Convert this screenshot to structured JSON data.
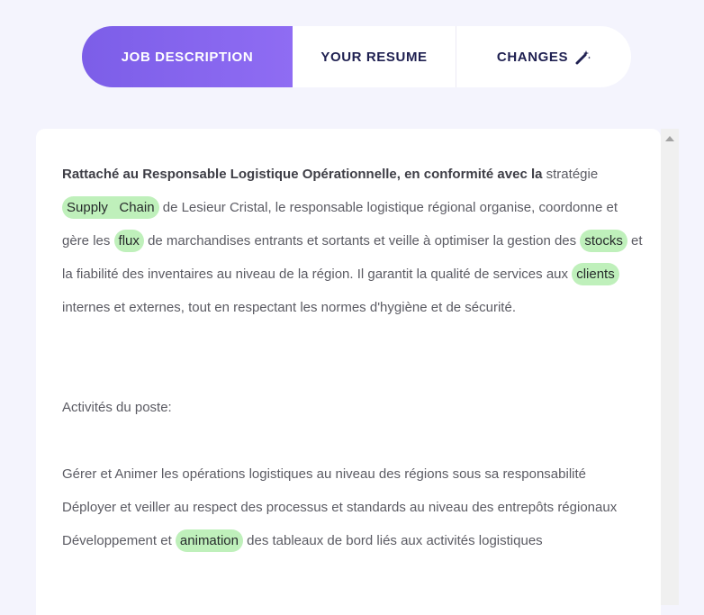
{
  "tabs": [
    {
      "label": "JOB DESCRIPTION",
      "active": true
    },
    {
      "label": "YOUR RESUME",
      "active": false
    },
    {
      "label": "CHANGES",
      "active": false,
      "icon": "magic-wand-icon"
    }
  ],
  "colors": {
    "accent": "#7c5ee8",
    "page_background": "#f4f4fd",
    "highlight": "#bff0bb",
    "tab_text": "#1f2051",
    "body_text": "#5b5b63"
  },
  "job_description": {
    "lead": "Rattaché au Responsable Logistique Opérationnelle, en conformité avec la",
    "p1_a": "stratégie",
    "kw_supply_chain": "Supply   Chain",
    "p1_b": "de Lesieur Cristal, le responsable logistique régional organise, coordonne et gère les",
    "kw_flux": "flux",
    "p1_c": "de marchandises entrants et sortants et veille à optimiser la gestion des",
    "kw_stocks": "stocks",
    "p1_d": "et la fiabilité des inventaires au niveau de la région. Il garantit la qualité de services aux",
    "kw_clients": "clients",
    "p1_e": "internes et externes, tout en respectant les normes d'hygiène et de sécurité.",
    "activities_title": "Activités du poste:",
    "activity_1": "Gérer et Animer les opérations logistiques au niveau des régions sous sa responsabilité",
    "activity_2": "Déployer et veiller au respect des processus et standards au niveau des entrepôts régionaux",
    "activity_3_a": "Développement et",
    "kw_animation": "animation",
    "activity_3_b": "des tableaux de bord liés aux activités logistiques"
  }
}
